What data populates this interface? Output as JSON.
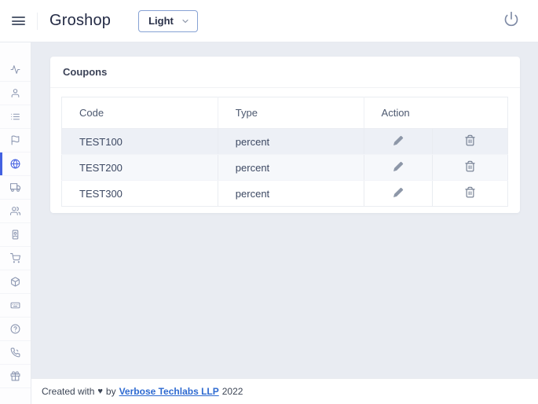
{
  "header": {
    "title": "Groshop",
    "theme_select": {
      "value": "Light"
    },
    "icons": {
      "menu": "menu-icon",
      "power": "power-icon",
      "chevron": "chevron-down-icon"
    }
  },
  "sidebar": {
    "items": [
      {
        "icon": "activity-icon",
        "active": false
      },
      {
        "icon": "user-icon",
        "active": false
      },
      {
        "icon": "list-icon",
        "active": false
      },
      {
        "icon": "flag-icon",
        "active": false
      },
      {
        "icon": "globe-icon",
        "active": true
      },
      {
        "icon": "truck-icon",
        "active": false
      },
      {
        "icon": "users-icon",
        "active": false
      },
      {
        "icon": "id-badge-icon",
        "active": false
      },
      {
        "icon": "cart-icon",
        "active": false
      },
      {
        "icon": "package-icon",
        "active": false
      },
      {
        "icon": "keyboard-icon",
        "active": false
      },
      {
        "icon": "help-circle-icon",
        "active": false
      },
      {
        "icon": "phone-icon",
        "active": false
      },
      {
        "icon": "gift-icon",
        "active": false
      }
    ]
  },
  "main": {
    "card": {
      "title": "Coupons",
      "table": {
        "columns": [
          "Code",
          "Type",
          "Action"
        ],
        "action_icons": [
          "pencil-icon",
          "trash-icon"
        ],
        "rows": [
          {
            "code": "TEST100",
            "type": "percent"
          },
          {
            "code": "TEST200",
            "type": "percent"
          },
          {
            "code": "TEST300",
            "type": "percent"
          }
        ]
      }
    }
  },
  "footer": {
    "prefix": "Created with",
    "heart": "♥",
    "middle": "by",
    "link": "Verbose Techlabs LLP",
    "year": "2022"
  },
  "colors": {
    "accent": "#4361e1",
    "active_icon": "#4864e2",
    "link": "#2e6ad1",
    "background": "#e9ecf2",
    "stripe_row1": "#edf0f6",
    "stripe_row2": "#f6f8fb",
    "select_border": "#87a2d4"
  }
}
